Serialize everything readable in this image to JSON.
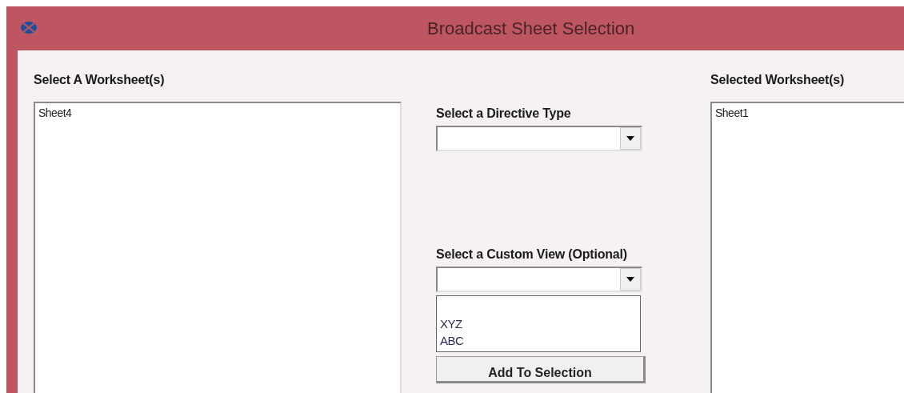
{
  "window": {
    "title": "Broadcast Sheet Selection"
  },
  "available": {
    "label": "Select A Worksheet(s)",
    "items": [
      "Sheet4"
    ]
  },
  "directive_type": {
    "label": "Select a Directive Type"
  },
  "custom_view": {
    "label": "Select a Custom View (Optional)",
    "expanded": true,
    "options": [
      "XYZ",
      "ABC"
    ]
  },
  "add_button": {
    "label": "Add To Selection"
  },
  "selected": {
    "label": "Selected Worksheet(s)",
    "items": [
      "Sheet1"
    ]
  }
}
